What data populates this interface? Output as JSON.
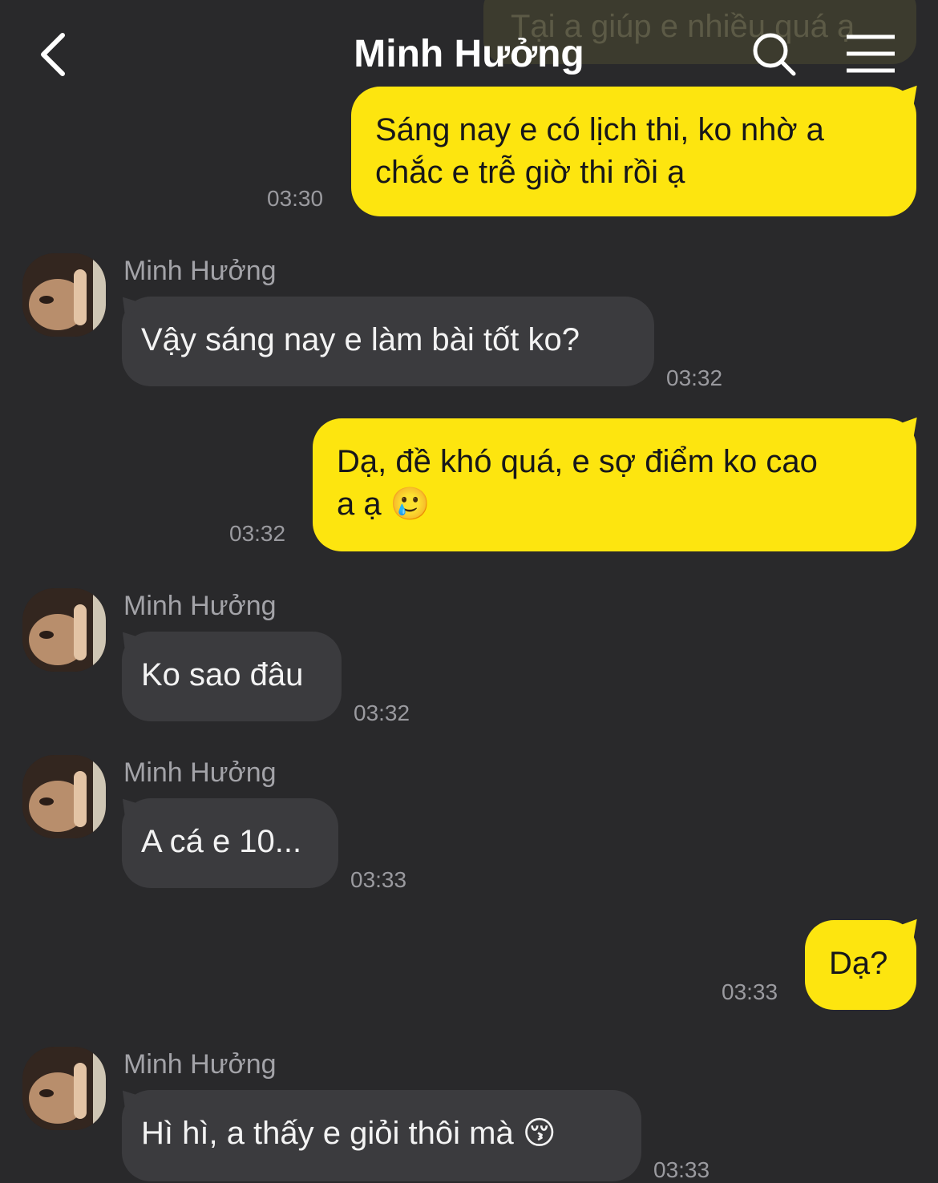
{
  "header": {
    "title": "Minh Hưởng",
    "back_icon": "chevron-left-icon",
    "search_icon": "search-icon",
    "menu_icon": "menu-icon"
  },
  "colors": {
    "background": "#29292b",
    "sent_bubble": "#fde50f",
    "received_bubble": "#3b3b3e",
    "timestamp": "#9a9a9f"
  },
  "messages": [
    {
      "direction": "sent",
      "text": "Tại a giúp e nhiều quá ạ",
      "partial": true
    },
    {
      "direction": "sent",
      "lines": [
        "Sáng nay e có lịch thi, ko nhờ a",
        "chắc e trễ giờ thi rồi ạ"
      ],
      "time": "03:30"
    },
    {
      "direction": "received",
      "sender": "Minh Hưởng",
      "text": "Vậy sáng nay e làm bài tốt ko?",
      "time": "03:32"
    },
    {
      "direction": "sent",
      "lines": [
        "Dạ, đề khó quá, e sợ điểm ko cao",
        "a ạ"
      ],
      "emoji": "🥲",
      "time": "03:32"
    },
    {
      "direction": "received",
      "sender": "Minh Hưởng",
      "text": "Ko sao đâu",
      "time": "03:32"
    },
    {
      "direction": "received",
      "sender": "Minh Hưởng",
      "text": "A cá e 10...",
      "time": "03:33"
    },
    {
      "direction": "sent",
      "text": "Dạ?",
      "time": "03:33"
    },
    {
      "direction": "received",
      "sender": "Minh Hưởng",
      "text": "Hì hì, a thấy e giỏi thôi mà",
      "emoji": "😚",
      "time": "03:33"
    }
  ]
}
